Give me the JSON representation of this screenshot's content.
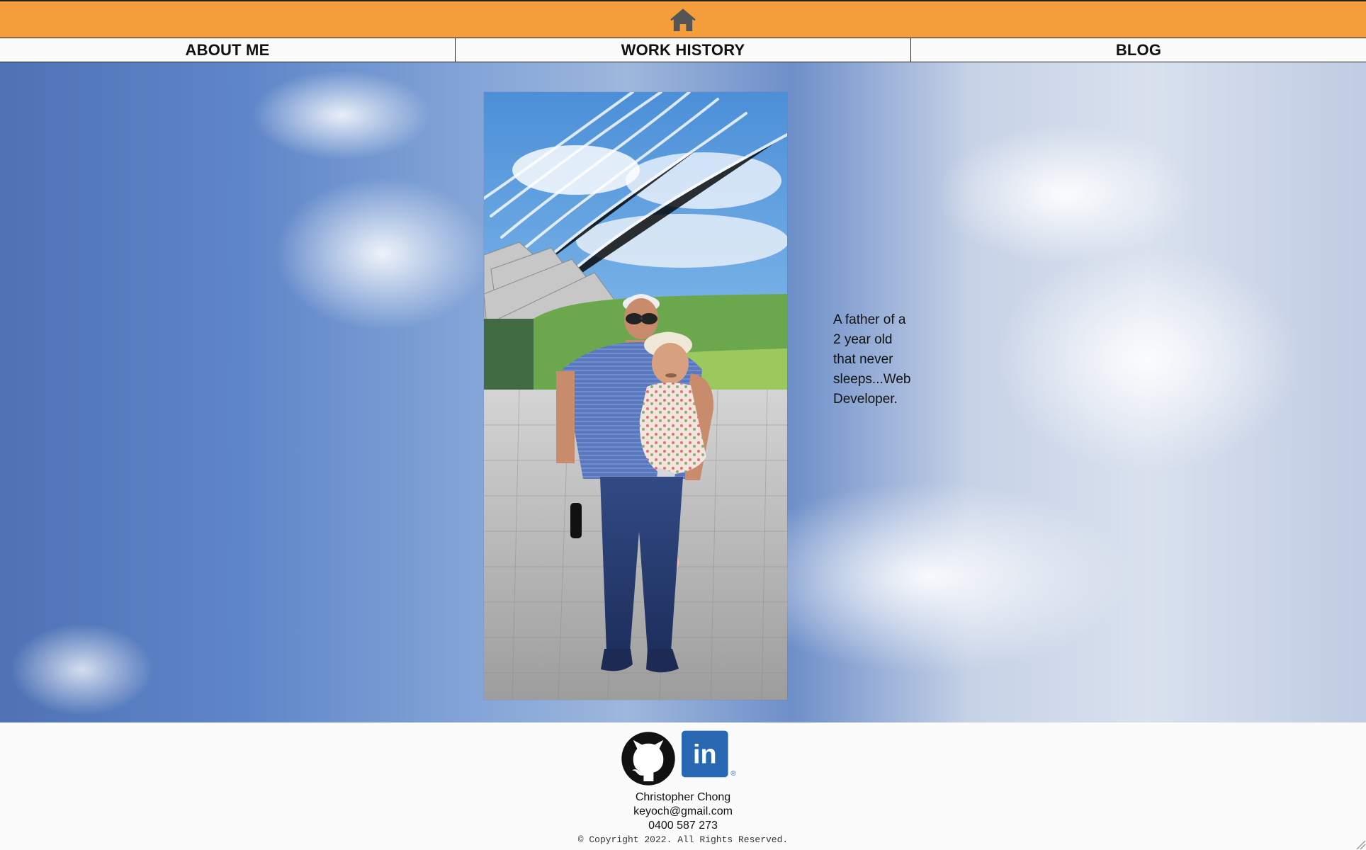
{
  "header": {
    "home_icon": "home-icon"
  },
  "nav": {
    "items": [
      {
        "label": "ABOUT ME"
      },
      {
        "label": "WORK HISTORY"
      },
      {
        "label": "BLOG"
      }
    ]
  },
  "hero": {
    "bio_lines": [
      "A father of a",
      "2 year old",
      "that never",
      "sleeps...Web",
      "Developer."
    ]
  },
  "footer": {
    "social": {
      "github_icon": "github-icon",
      "linkedin_icon": "linkedin-icon",
      "linkedin_text": "in",
      "registered_mark": "®"
    },
    "contact": {
      "name": "Christopher Chong",
      "email": "keyoch@gmail.com",
      "phone": "0400 587 273"
    },
    "copyright": "© Copyright 2022. All Rights Reserved."
  },
  "colors": {
    "header_bg": "#f39e3b",
    "nav_bg": "#fbfbfb",
    "linkedin_blue": "#2867b2",
    "github_black": "#111111"
  }
}
